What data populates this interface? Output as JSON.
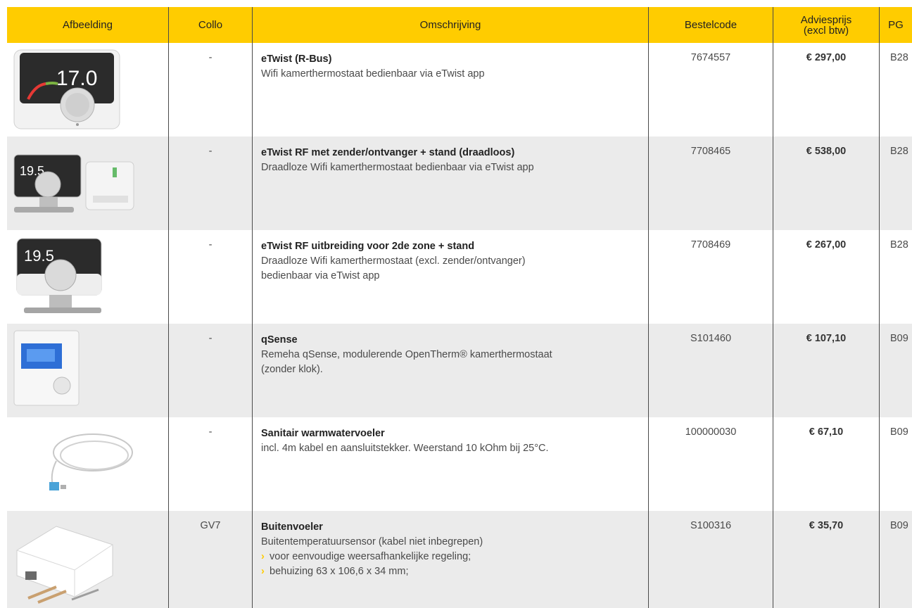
{
  "header": {
    "image": "Afbeelding",
    "collo": "Collo",
    "description": "Omschrijving",
    "code": "Bestelcode",
    "price_line1": "Adviesprijs",
    "price_line2": "(excl btw)",
    "pg": "PG"
  },
  "rows": [
    {
      "collo": "-",
      "title": "eTwist (R-Bus)",
      "desc": [
        "Wifi kamerthermostaat bedienbaar via eTwist app"
      ],
      "code": "7674557",
      "price": "€ 297,00",
      "pg": "B28",
      "image_text": "17.0"
    },
    {
      "collo": "-",
      "title": "eTwist RF met zender/ontvanger + stand (draadloos)",
      "desc": [
        "Draadloze Wifi kamerthermostaat bedienbaar via eTwist app"
      ],
      "code": "7708465",
      "price": "€ 538,00",
      "pg": "B28",
      "image_text": "19.5"
    },
    {
      "collo": "-",
      "title": "eTwist RF uitbreiding voor 2de zone + stand",
      "desc": [
        "Draadloze Wifi kamerthermostaat (excl. zender/ontvanger)",
        "bedienbaar via eTwist app"
      ],
      "code": "7708469",
      "price": "€ 267,00",
      "pg": "B28",
      "image_text": "19.5"
    },
    {
      "collo": "-",
      "title": "qSense",
      "desc": [
        "Remeha qSense, modulerende OpenTherm® kamerthermostaat",
        "(zonder klok)."
      ],
      "code": "S101460",
      "price": "€ 107,10",
      "pg": "B09"
    },
    {
      "collo": "-",
      "title": "Sanitair warmwatervoeler",
      "desc": [
        "incl. 4m kabel en aansluitstekker. Weerstand 10 kOhm bij 25°C."
      ],
      "code": "100000030",
      "price": "€ 67,10",
      "pg": "B09"
    },
    {
      "collo": "GV7",
      "title": "Buitenvoeler",
      "desc": [
        "Buitentemperatuursensor (kabel niet inbegrepen)"
      ],
      "bullets": [
        "voor eenvoudige weersafhankelijke regeling;",
        "behuizing 63 x 106,6 x 34 mm;"
      ],
      "bullet_mark": "›",
      "code": "S100316",
      "price": "€ 35,70",
      "pg": "B09"
    }
  ],
  "colors": {
    "header_bg": "#ffcc00",
    "shaded_row": "#ebebeb",
    "text": "#4a4a4a"
  }
}
